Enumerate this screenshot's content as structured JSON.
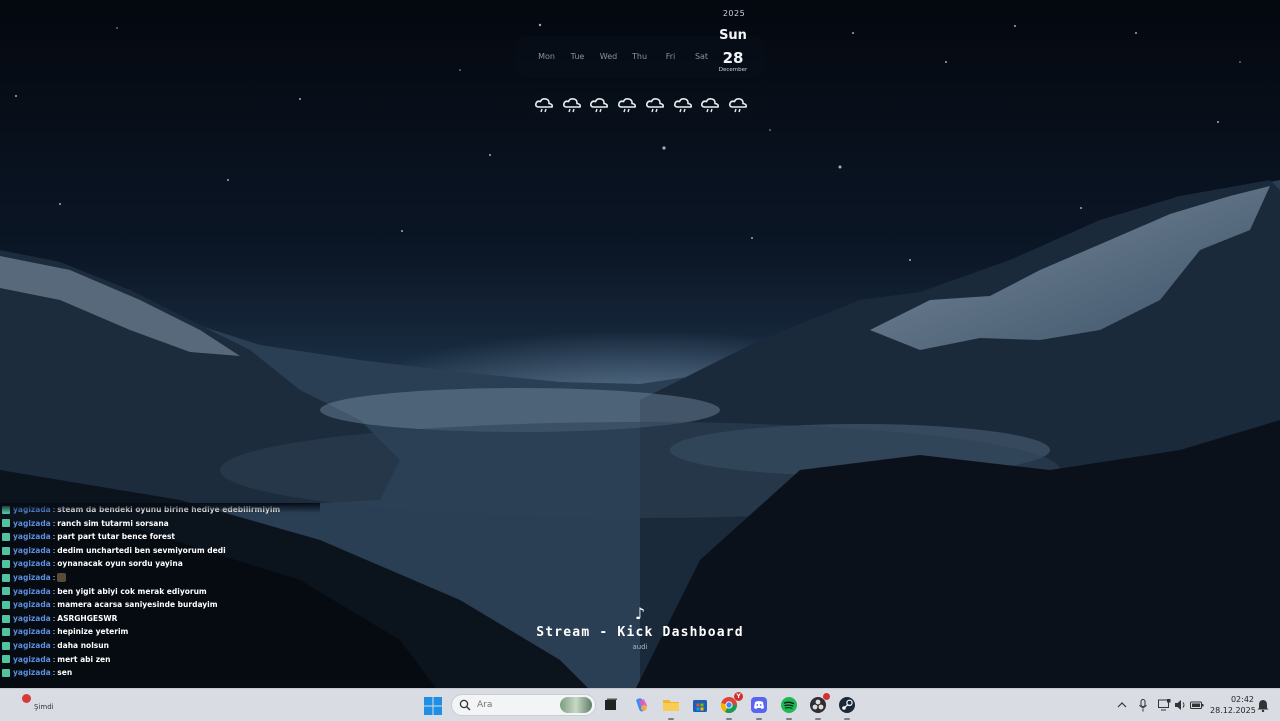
{
  "calendar": {
    "year": "2025",
    "weekdays": [
      "Mon",
      "Tue",
      "Wed",
      "Thu",
      "Fri",
      "Sat"
    ],
    "today_name": "Sun",
    "today_number": "28",
    "today_month": "December",
    "weather_icon": "cloud-rain-icon"
  },
  "chat": {
    "messages": [
      {
        "user": "yagizada",
        "text": "steam da bendeki oyunu birine hediye edebilirmiyim"
      },
      {
        "user": "yagizada",
        "text": "ranch sim tutarmi sorsana"
      },
      {
        "user": "yagizada",
        "text": "part part tutar bence forest"
      },
      {
        "user": "yagizada",
        "text": "dedim unchartedi ben sevmiyorum dedi"
      },
      {
        "user": "yagizada",
        "text": "oynanacak oyun sordu yayina"
      },
      {
        "user": "yagizada",
        "text": "",
        "emote": true
      },
      {
        "user": "yagizada",
        "text": "ben yigit abiyi cok merak ediyorum"
      },
      {
        "user": "yagizada",
        "text": "mamera acarsa saniyesinde burdayim"
      },
      {
        "user": "yagizada",
        "text": "ASRGHGESWR"
      },
      {
        "user": "yagizada",
        "text": "hepinize yeterim"
      },
      {
        "user": "yagizada",
        "text": "daha nolsun"
      },
      {
        "user": "yagizada",
        "text": "mert abi zen"
      },
      {
        "user": "yagizada",
        "text": "sen"
      }
    ]
  },
  "media": {
    "icon": "music-note-icon",
    "title": "Stream - Kick Dashboard",
    "artist": "audi"
  },
  "taskbar": {
    "notification_text": "Şimdi",
    "search_placeholder": "Ara",
    "apps": [
      {
        "name": "task-view",
        "icon": "task-view-icon"
      },
      {
        "name": "copilot",
        "icon": "copilot-icon"
      },
      {
        "name": "file-explorer",
        "icon": "folder-icon"
      },
      {
        "name": "microsoft-store",
        "icon": "store-icon"
      },
      {
        "name": "chrome",
        "icon": "chrome-icon",
        "badge": "Y"
      },
      {
        "name": "discord",
        "icon": "discord-icon"
      },
      {
        "name": "spotify",
        "icon": "spotify-icon"
      },
      {
        "name": "obs",
        "icon": "obs-icon"
      },
      {
        "name": "steam",
        "icon": "steam-icon"
      }
    ],
    "time": "02:42",
    "date": "28.12.2025"
  },
  "colors": {
    "chat_user": "#5b8fe0",
    "taskbar_bg": "#d9dde3",
    "sky_top": "#050a14"
  }
}
